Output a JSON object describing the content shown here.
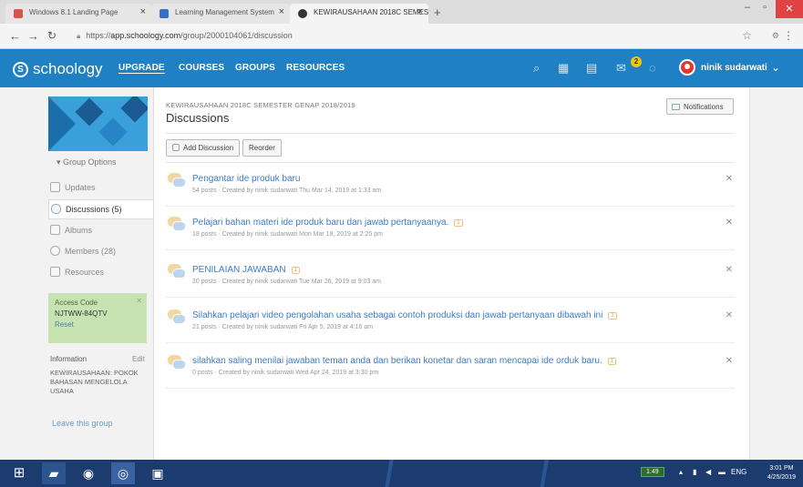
{
  "browser": {
    "tabs": [
      {
        "label": "Windows 8.1 Landing Page",
        "color": "#d9534f"
      },
      {
        "label": "Learning Management System",
        "color": "#2f74c4"
      },
      {
        "label": "KEWIRAUSAHAAN 2018C SEMES",
        "color": "#333333"
      }
    ],
    "new_tab": "+",
    "url_protocol": "https://",
    "url_host": "app.schoology.com",
    "url_path": "/group/2000104061/discussion"
  },
  "header": {
    "logo": "schoology",
    "nav": [
      "UPGRADE",
      "COURSES",
      "GROUPS",
      "RESOURCES"
    ],
    "message_badge": "2",
    "user_name": "ninik sudarwati",
    "brand_color": "#1f80c4"
  },
  "sidebar": {
    "group_options": "Group Options",
    "items": [
      {
        "label": "Updates",
        "icon": "updates-icon"
      },
      {
        "label": "Discussions (5)",
        "icon": "discussions-icon"
      },
      {
        "label": "Albums",
        "icon": "albums-icon"
      },
      {
        "label": "Members (28)",
        "icon": "members-icon"
      },
      {
        "label": "Resources",
        "icon": "resources-icon"
      }
    ],
    "access_code_title": "Access Code",
    "access_code": "NJTWW-84QTV",
    "access_reset": "Reset",
    "info_title": "Information",
    "info_edit": "Edit",
    "info_text": "KEWIRAUSAHAAN: POKOK BAHASAN MENGELOLA USAHA",
    "leave": "Leave this group"
  },
  "main": {
    "breadcrumb": "KEWIRAUSAHAAN 2018C SEMESTER GENAP 2018/2019",
    "title": "Discussions",
    "notifications": "Notifications",
    "add_discussion": "Add Discussion",
    "reorder": "Reorder",
    "discussions": [
      {
        "title": "Pengantar ide produk baru",
        "comments": "",
        "meta": "54 posts · Created by ninik sudarwati Thu Mar 14, 2019 at 1:33 am"
      },
      {
        "title": "Pelajari bahan materi ide produk baru dan jawab pertanyaanya.",
        "comments": "1",
        "meta": "18 posts · Created by ninik sudarwati Mon Mar 18, 2019 at 2:25 pm"
      },
      {
        "title": "PENILAIAN JAWABAN",
        "comments": "1",
        "meta": "20 posts · Created by ninik sudarwati Tue Mar 26, 2019 at 9:03 am"
      },
      {
        "title": "Silahkan pelajari video pengolahan usaha sebagai contoh produksi dan jawab pertanyaan dibawah ini",
        "comments": "1",
        "meta": "21 posts · Created by ninik sudarwati Fri Apr 5, 2019 at 4:16 am"
      },
      {
        "title": "silahkan saling menilai jawaban teman anda dan berikan konetar dan saran mencapai ide orduk baru.",
        "comments": "1",
        "meta": "0 posts · Created by ninik sudarwati Wed Apr 24, 2019 at 3:30 pm"
      }
    ]
  },
  "taskbar": {
    "battery": "1:49",
    "lang": "ENG",
    "time": "3:01 PM",
    "date": "4/25/2019"
  }
}
